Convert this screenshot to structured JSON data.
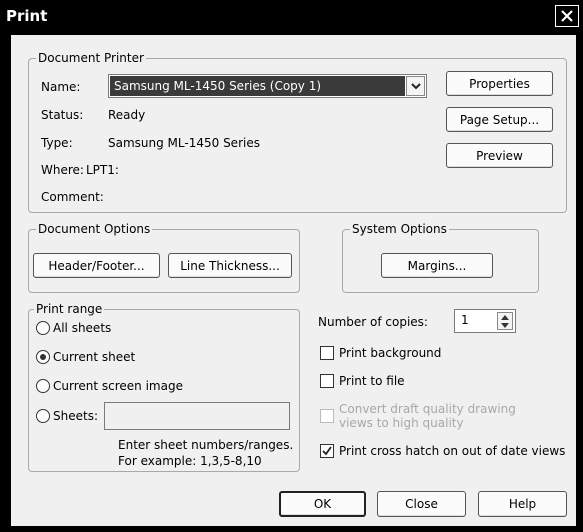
{
  "window": {
    "title": "Print"
  },
  "document_printer": {
    "legend": "Document Printer",
    "name_label": "Name:",
    "name_value": "Samsung ML-1450 Series (Copy 1)",
    "status_label": "Status:",
    "status_value": "Ready",
    "type_label": "Type:",
    "type_value": "Samsung ML-1450 Series",
    "where_label": "Where:",
    "where_value": "LPT1:",
    "comment_label": "Comment:",
    "properties_label": "Properties",
    "page_setup_label": "Page Setup...",
    "preview_label": "Preview"
  },
  "document_options": {
    "legend": "Document Options",
    "header_footer_label": "Header/Footer...",
    "line_thickness_label": "Line Thickness..."
  },
  "system_options": {
    "legend": "System Options",
    "margins_label": "Margins..."
  },
  "print_range": {
    "legend": "Print range",
    "all_sheets": "All sheets",
    "current_sheet": "Current sheet",
    "current_screen_image": "Current screen image",
    "sheets": "Sheets:",
    "sheets_value": "",
    "hint_line1": "Enter sheet numbers/ranges.",
    "hint_line2": "For example: 1,3,5-8,10",
    "selected": "Current sheet"
  },
  "copies": {
    "label": "Number of copies:",
    "value": "1"
  },
  "options": {
    "print_background": {
      "label": "Print background",
      "checked": false
    },
    "print_to_file": {
      "label": "Print to file",
      "checked": false
    },
    "convert_draft_line1": "Convert draft quality drawing",
    "convert_draft_line2": "views to high quality",
    "print_cross_hatch": {
      "label": "Print cross hatch on out of date views",
      "checked": true
    }
  },
  "footer": {
    "ok_label": "OK",
    "close_label": "Close",
    "help_label": "Help"
  }
}
